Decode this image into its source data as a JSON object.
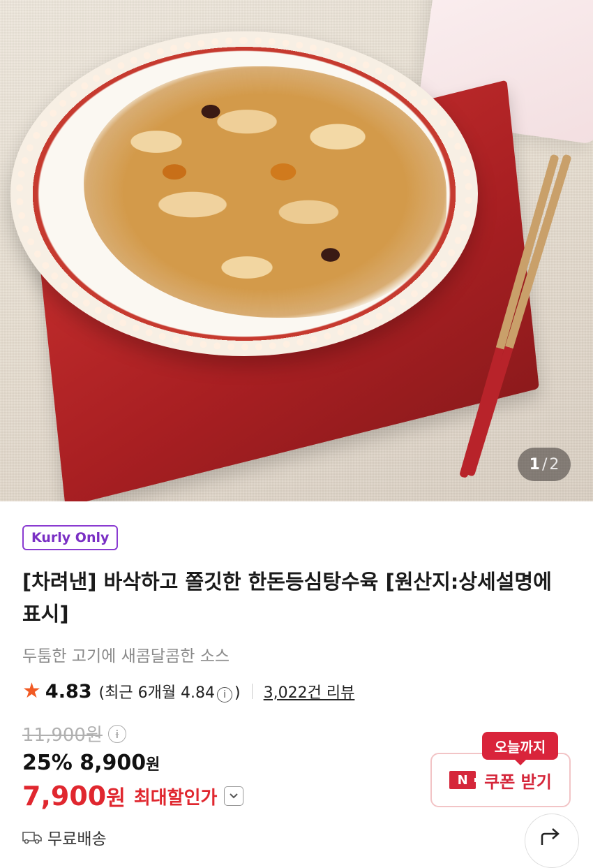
{
  "image_viewer": {
    "current_page": "1",
    "separator": "/",
    "total_pages": "2"
  },
  "product": {
    "badge": "Kurly Only",
    "title": "[차려낸] 바삭하고 쫄깃한 한돈등심탕수육 [원산지:상세설명에 표시]",
    "subtitle": "두툼한 고기에 새콤달콤한 소스"
  },
  "rating": {
    "score": "4.83",
    "recent_prefix": "(최근 6개월 4.84",
    "recent_suffix": ")",
    "review_count": "3,022건 리뷰"
  },
  "price": {
    "original": "11,900원",
    "discount_rate": "25%",
    "discounted": "8,900",
    "won": "원",
    "final_price": "7,900",
    "final_won": "원",
    "max_discount_label": "최대할인가"
  },
  "coupon": {
    "tag": "오늘까지",
    "n_label": "N",
    "button_label": "쿠폰 받기"
  },
  "delivery": {
    "label": "무료배송"
  },
  "colors": {
    "brand_purple": "#7a2fc4",
    "sale_red": "#e0272f",
    "star_orange": "#f15a24",
    "coupon_red": "#d5263a"
  }
}
